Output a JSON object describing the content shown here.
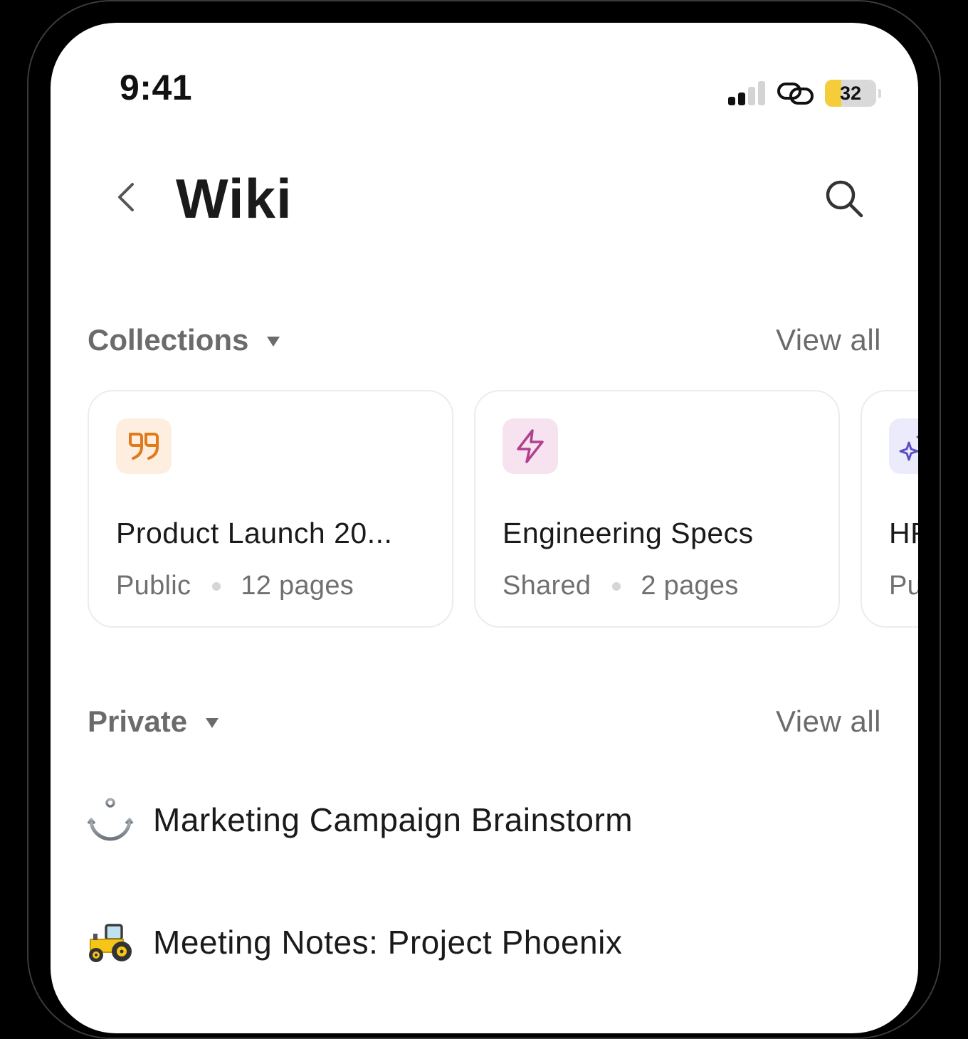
{
  "status_bar": {
    "time": "9:41",
    "battery_level": "32",
    "battery_fraction": 0.32
  },
  "header": {
    "title": "Wiki",
    "back_icon": "chevron-left-icon",
    "search_icon": "search-icon"
  },
  "collections": {
    "title": "Collections",
    "view_all": "View all",
    "cards": [
      {
        "icon": "quote-icon",
        "icon_color": "#e07b1a",
        "icon_bg": "#fdeee0",
        "title": "Product Launch 20...",
        "visibility": "Public",
        "pages": "12 pages"
      },
      {
        "icon": "lightning-icon",
        "icon_color": "#b0418f",
        "icon_bg": "#f7e3ef",
        "title": "Engineering Specs",
        "visibility": "Shared",
        "pages": "2 pages"
      },
      {
        "icon": "sparkle-icon",
        "icon_color": "#5a4fc4",
        "icon_bg": "#ecebfb",
        "title": "HR Policies",
        "visibility": "Public",
        "pages": ""
      }
    ]
  },
  "private": {
    "title": "Private",
    "view_all": "View all",
    "items": [
      {
        "icon": "anchor-icon",
        "label": "Marketing Campaign Brainstorm"
      },
      {
        "icon": "tractor-icon",
        "label": "Meeting Notes: Project Phoenix"
      }
    ]
  }
}
